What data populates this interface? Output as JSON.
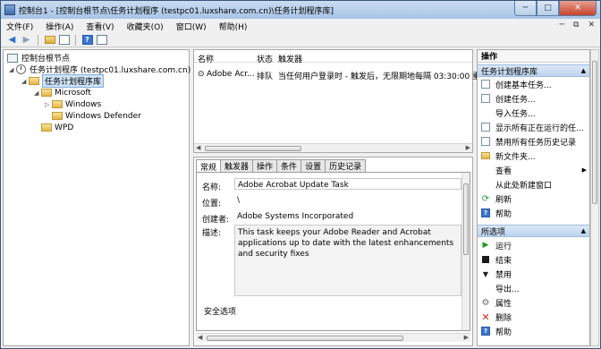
{
  "window": {
    "title": "控制台1 - [控制台根节点\\任务计划程序 (testpc01.luxshare.com.cn)\\任务计划程序库]",
    "minimize": "─",
    "maximize": "□",
    "close": "✕"
  },
  "menu": {
    "items": [
      "文件(F)",
      "操作(A)",
      "查看(V)",
      "收藏夹(O)",
      "窗口(W)",
      "帮助(H)"
    ],
    "end_controls": [
      "─",
      "⧉",
      "✕"
    ]
  },
  "toolbar": {
    "back": "◀",
    "forward": "▶",
    "help": "?"
  },
  "tree": {
    "root": "控制台根节点",
    "scheduler": "任务计划程序 (testpc01.luxshare.com.cn)",
    "library": "任务计划程序库",
    "microsoft": "Microsoft",
    "windows": "Windows",
    "windows_defender": "Windows Defender",
    "wpd": "WPD"
  },
  "task_list": {
    "headers": [
      "名称",
      "状态",
      "触发器"
    ],
    "rows": [
      {
        "name": "Adobe Acr...",
        "status": "排队",
        "trigger": "当任何用户登录时 - 触发后，无限期地每隔 03:30:00 重复一次"
      }
    ]
  },
  "details": {
    "tabs": [
      "常规",
      "触发器",
      "操作",
      "条件",
      "设置",
      "历史记录"
    ],
    "labels": {
      "name": "名称:",
      "location": "位置:",
      "author": "创建者:",
      "description": "描述:"
    },
    "values": {
      "name": "Adobe Acrobat Update Task",
      "location": "\\",
      "author": "Adobe Systems Incorporated",
      "description": "This task keeps your Adobe Reader and Acrobat applications up to date with the latest enhancements and security fixes"
    },
    "security_group": "安全选项"
  },
  "actions": {
    "title": "操作",
    "section1": "任务计划程序库",
    "section1_items": [
      {
        "icon": "create-basic-task-icon",
        "label": "创建基本任务..."
      },
      {
        "icon": "create-task-icon",
        "label": "创建任务..."
      },
      {
        "icon": "blank",
        "label": "导入任务..."
      },
      {
        "icon": "running-tasks-icon",
        "label": "显示所有正在运行的任..."
      },
      {
        "icon": "history-icon",
        "label": "禁用所有任务历史记录"
      },
      {
        "icon": "folder-icon",
        "label": "新文件夹..."
      },
      {
        "icon": "blank",
        "label": "查看"
      },
      {
        "icon": "blank",
        "label": "从此处新建窗口"
      },
      {
        "icon": "refresh-icon",
        "label": "刷新"
      },
      {
        "icon": "help-icon",
        "label": "帮助"
      }
    ],
    "section2": "所选项",
    "section2_items": [
      {
        "icon": "run-icon",
        "label": "运行"
      },
      {
        "icon": "end-icon",
        "label": "结束"
      },
      {
        "icon": "disable-icon",
        "label": "禁用"
      },
      {
        "icon": "blank",
        "label": "导出..."
      },
      {
        "icon": "properties-icon",
        "label": "属性"
      },
      {
        "icon": "delete-icon",
        "label": "删除"
      },
      {
        "icon": "help-icon",
        "label": "帮助"
      }
    ]
  }
}
